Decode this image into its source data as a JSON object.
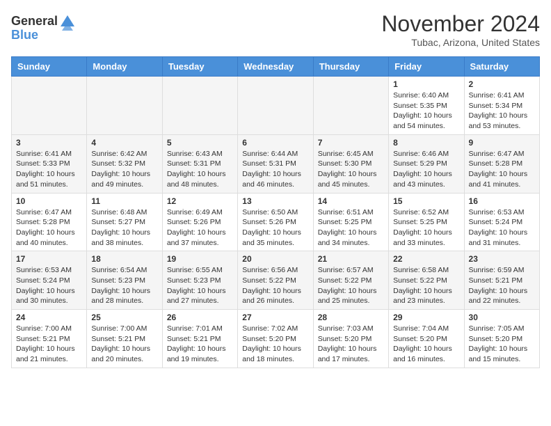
{
  "header": {
    "logo_general": "General",
    "logo_blue": "Blue",
    "month": "November 2024",
    "location": "Tubac, Arizona, United States"
  },
  "weekdays": [
    "Sunday",
    "Monday",
    "Tuesday",
    "Wednesday",
    "Thursday",
    "Friday",
    "Saturday"
  ],
  "weeks": [
    [
      {
        "day": "",
        "info": ""
      },
      {
        "day": "",
        "info": ""
      },
      {
        "day": "",
        "info": ""
      },
      {
        "day": "",
        "info": ""
      },
      {
        "day": "",
        "info": ""
      },
      {
        "day": "1",
        "info": "Sunrise: 6:40 AM\nSunset: 5:35 PM\nDaylight: 10 hours and 54 minutes."
      },
      {
        "day": "2",
        "info": "Sunrise: 6:41 AM\nSunset: 5:34 PM\nDaylight: 10 hours and 53 minutes."
      }
    ],
    [
      {
        "day": "3",
        "info": "Sunrise: 6:41 AM\nSunset: 5:33 PM\nDaylight: 10 hours and 51 minutes."
      },
      {
        "day": "4",
        "info": "Sunrise: 6:42 AM\nSunset: 5:32 PM\nDaylight: 10 hours and 49 minutes."
      },
      {
        "day": "5",
        "info": "Sunrise: 6:43 AM\nSunset: 5:31 PM\nDaylight: 10 hours and 48 minutes."
      },
      {
        "day": "6",
        "info": "Sunrise: 6:44 AM\nSunset: 5:31 PM\nDaylight: 10 hours and 46 minutes."
      },
      {
        "day": "7",
        "info": "Sunrise: 6:45 AM\nSunset: 5:30 PM\nDaylight: 10 hours and 45 minutes."
      },
      {
        "day": "8",
        "info": "Sunrise: 6:46 AM\nSunset: 5:29 PM\nDaylight: 10 hours and 43 minutes."
      },
      {
        "day": "9",
        "info": "Sunrise: 6:47 AM\nSunset: 5:28 PM\nDaylight: 10 hours and 41 minutes."
      }
    ],
    [
      {
        "day": "10",
        "info": "Sunrise: 6:47 AM\nSunset: 5:28 PM\nDaylight: 10 hours and 40 minutes."
      },
      {
        "day": "11",
        "info": "Sunrise: 6:48 AM\nSunset: 5:27 PM\nDaylight: 10 hours and 38 minutes."
      },
      {
        "day": "12",
        "info": "Sunrise: 6:49 AM\nSunset: 5:26 PM\nDaylight: 10 hours and 37 minutes."
      },
      {
        "day": "13",
        "info": "Sunrise: 6:50 AM\nSunset: 5:26 PM\nDaylight: 10 hours and 35 minutes."
      },
      {
        "day": "14",
        "info": "Sunrise: 6:51 AM\nSunset: 5:25 PM\nDaylight: 10 hours and 34 minutes."
      },
      {
        "day": "15",
        "info": "Sunrise: 6:52 AM\nSunset: 5:25 PM\nDaylight: 10 hours and 33 minutes."
      },
      {
        "day": "16",
        "info": "Sunrise: 6:53 AM\nSunset: 5:24 PM\nDaylight: 10 hours and 31 minutes."
      }
    ],
    [
      {
        "day": "17",
        "info": "Sunrise: 6:53 AM\nSunset: 5:24 PM\nDaylight: 10 hours and 30 minutes."
      },
      {
        "day": "18",
        "info": "Sunrise: 6:54 AM\nSunset: 5:23 PM\nDaylight: 10 hours and 28 minutes."
      },
      {
        "day": "19",
        "info": "Sunrise: 6:55 AM\nSunset: 5:23 PM\nDaylight: 10 hours and 27 minutes."
      },
      {
        "day": "20",
        "info": "Sunrise: 6:56 AM\nSunset: 5:22 PM\nDaylight: 10 hours and 26 minutes."
      },
      {
        "day": "21",
        "info": "Sunrise: 6:57 AM\nSunset: 5:22 PM\nDaylight: 10 hours and 25 minutes."
      },
      {
        "day": "22",
        "info": "Sunrise: 6:58 AM\nSunset: 5:22 PM\nDaylight: 10 hours and 23 minutes."
      },
      {
        "day": "23",
        "info": "Sunrise: 6:59 AM\nSunset: 5:21 PM\nDaylight: 10 hours and 22 minutes."
      }
    ],
    [
      {
        "day": "24",
        "info": "Sunrise: 7:00 AM\nSunset: 5:21 PM\nDaylight: 10 hours and 21 minutes."
      },
      {
        "day": "25",
        "info": "Sunrise: 7:00 AM\nSunset: 5:21 PM\nDaylight: 10 hours and 20 minutes."
      },
      {
        "day": "26",
        "info": "Sunrise: 7:01 AM\nSunset: 5:21 PM\nDaylight: 10 hours and 19 minutes."
      },
      {
        "day": "27",
        "info": "Sunrise: 7:02 AM\nSunset: 5:20 PM\nDaylight: 10 hours and 18 minutes."
      },
      {
        "day": "28",
        "info": "Sunrise: 7:03 AM\nSunset: 5:20 PM\nDaylight: 10 hours and 17 minutes."
      },
      {
        "day": "29",
        "info": "Sunrise: 7:04 AM\nSunset: 5:20 PM\nDaylight: 10 hours and 16 minutes."
      },
      {
        "day": "30",
        "info": "Sunrise: 7:05 AM\nSunset: 5:20 PM\nDaylight: 10 hours and 15 minutes."
      }
    ]
  ]
}
